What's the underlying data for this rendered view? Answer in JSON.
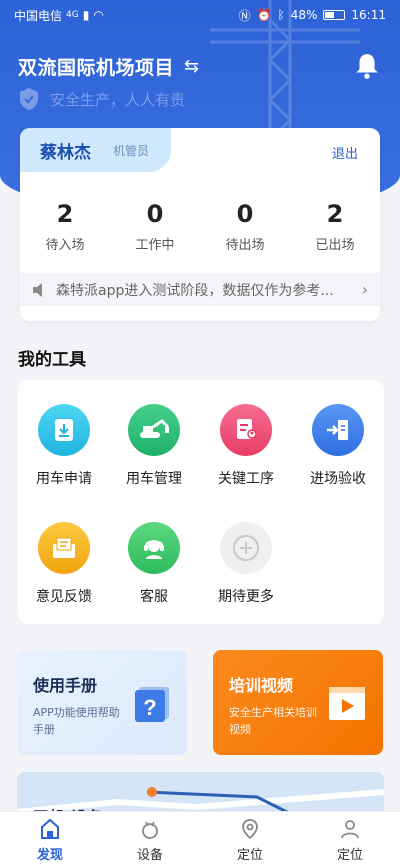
{
  "status_bar": {
    "carrier": "中国电信",
    "network": "4G",
    "battery": "48%",
    "time": "16:11"
  },
  "header": {
    "project_title": "双流国际机场项目",
    "slogan": "安全生产，人人有责"
  },
  "user": {
    "name": "蔡林杰",
    "role": "机管员",
    "logout_label": "退出"
  },
  "stats": [
    {
      "value": "2",
      "label": "待入场"
    },
    {
      "value": "0",
      "label": "工作中"
    },
    {
      "value": "0",
      "label": "待出场"
    },
    {
      "value": "2",
      "label": "已出场"
    }
  ],
  "notice": {
    "text": "森特派app进入测试阶段，数据仅作为参考..."
  },
  "tools": {
    "title": "我的工具",
    "items": [
      {
        "label": "用车申请",
        "icon": "car-request-icon",
        "color": "#2ec5e8"
      },
      {
        "label": "用车管理",
        "icon": "excavator-icon",
        "color": "#2fc07a"
      },
      {
        "label": "关键工序",
        "icon": "document-user-icon",
        "color": "#f2557a"
      },
      {
        "label": "进场验收",
        "icon": "entry-check-icon",
        "color": "#3b82f0"
      },
      {
        "label": "意见反馈",
        "icon": "feedback-icon",
        "color": "#f7b623"
      },
      {
        "label": "客服",
        "icon": "customer-service-icon",
        "color": "#3dca6b"
      },
      {
        "label": "期待更多",
        "icon": "plus-circle-icon",
        "color": "#eeeeee"
      }
    ]
  },
  "promos": {
    "manual": {
      "title": "使用手册",
      "desc": "APP功能使用帮助手册"
    },
    "video": {
      "title": "培训视频",
      "desc": "安全生产相关培训视频"
    }
  },
  "map": {
    "hint": "司机/设备"
  },
  "bottom_nav": [
    {
      "label": "发现",
      "icon": "discover-home-icon",
      "active": true
    },
    {
      "label": "设备",
      "icon": "device-icon",
      "active": false
    },
    {
      "label": "定位",
      "icon": "location-pin-icon",
      "active": false
    },
    {
      "label": "定位",
      "icon": "person-location-icon",
      "active": false
    }
  ]
}
